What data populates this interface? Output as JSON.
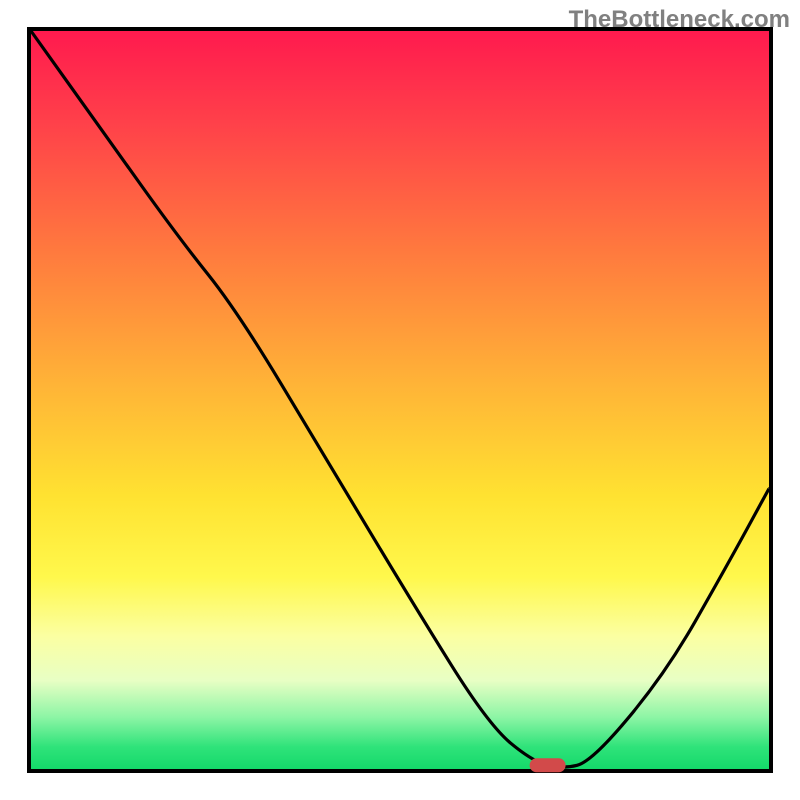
{
  "watermark": "TheBottleneck.com",
  "chart_data": {
    "type": "line",
    "title": "",
    "xlabel": "",
    "ylabel": "",
    "xlim": [
      0,
      100
    ],
    "ylim": [
      0,
      100
    ],
    "grid": false,
    "legend": false,
    "series": [
      {
        "name": "bottleneck-curve",
        "x": [
          0,
          10,
          20,
          28,
          40,
          52,
          62,
          68,
          72,
          76,
          86,
          94,
          100
        ],
        "y": [
          100,
          86,
          72,
          62,
          42,
          22,
          6,
          1,
          0,
          1,
          13,
          27,
          38
        ]
      }
    ],
    "marker": {
      "name": "optimal-point",
      "x": 70,
      "y": 0.5,
      "color": "#d24a4a"
    },
    "background_gradient": {
      "top": "#ff1a4e",
      "mid_upper": "#ffb437",
      "mid_lower": "#fff84c",
      "bottom": "#14d96a"
    }
  }
}
